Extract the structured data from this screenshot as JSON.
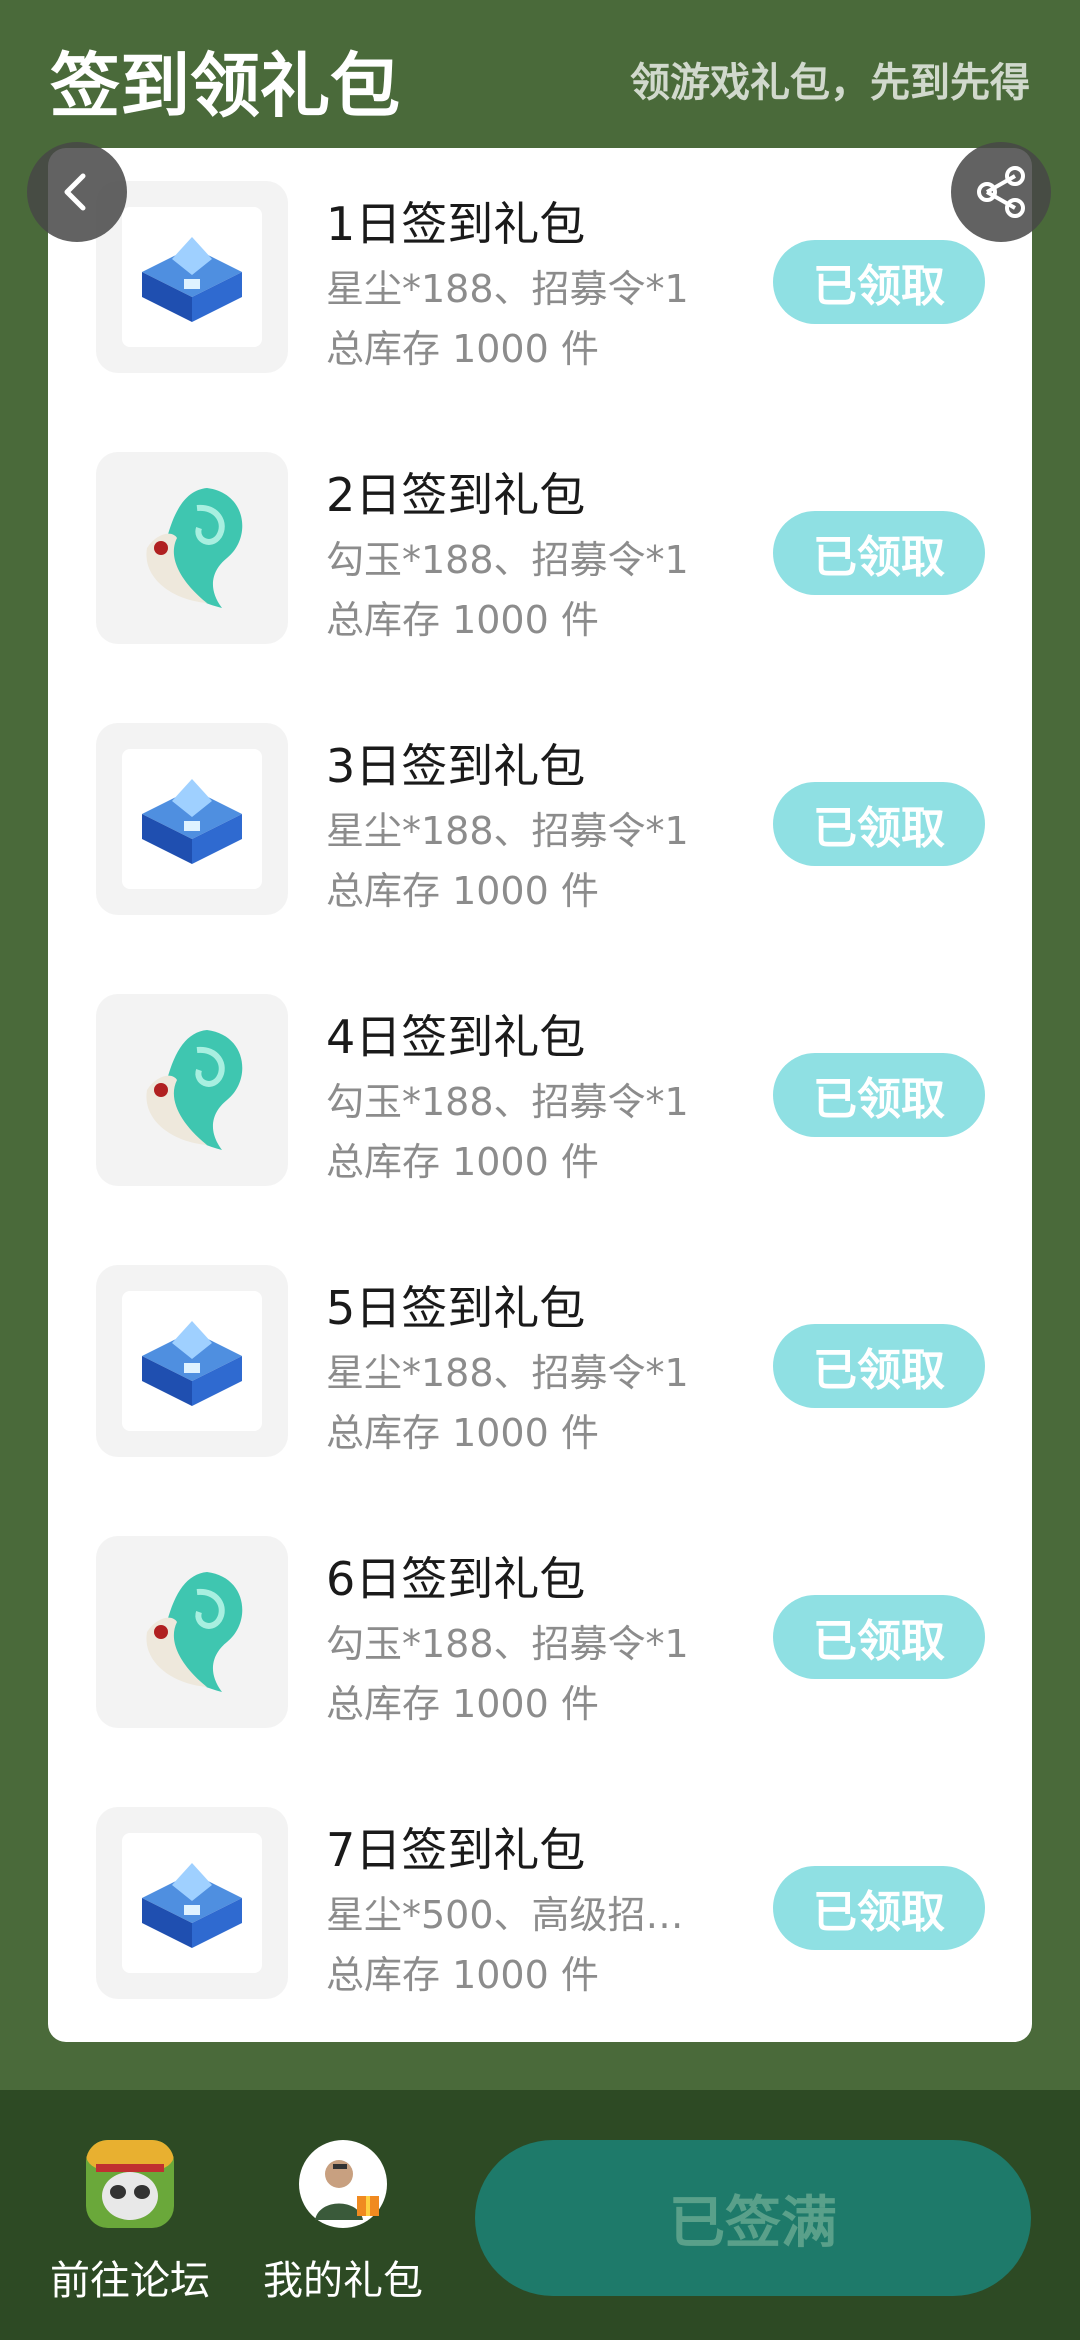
{
  "header": {
    "title": "签到领礼包",
    "subtitle": "领游戏礼包，先到先得"
  },
  "gifts": [
    {
      "name": "1日签到礼包",
      "items": "星尘*188、招募令*1",
      "stock": "总库存 1000 件",
      "button": "已领取",
      "icon": "blue-chest-icon"
    },
    {
      "name": "2日签到礼包",
      "items": "勾玉*188、招募令*1",
      "stock": "总库存 1000 件",
      "button": "已领取",
      "icon": "jade-magatama-icon"
    },
    {
      "name": "3日签到礼包",
      "items": "星尘*188、招募令*1",
      "stock": "总库存 1000 件",
      "button": "已领取",
      "icon": "blue-chest-icon"
    },
    {
      "name": "4日签到礼包",
      "items": "勾玉*188、招募令*1",
      "stock": "总库存 1000 件",
      "button": "已领取",
      "icon": "jade-magatama-icon"
    },
    {
      "name": "5日签到礼包",
      "items": "星尘*188、招募令*1",
      "stock": "总库存 1000 件",
      "button": "已领取",
      "icon": "blue-chest-icon"
    },
    {
      "name": "6日签到礼包",
      "items": "勾玉*188、招募令*1",
      "stock": "总库存 1000 件",
      "button": "已领取",
      "icon": "jade-magatama-icon"
    },
    {
      "name": "7日签到礼包",
      "items": "星尘*500、高级招…",
      "stock": "总库存 1000 件",
      "button": "已领取",
      "icon": "blue-chest-icon"
    }
  ],
  "footer": {
    "forum_label": "前往论坛",
    "mygifts_label": "我的礼包",
    "signed_label": "已签满"
  },
  "colors": {
    "background": "#4a6a3a",
    "claim_button": "#8fe0e3",
    "signed_button": "#1e7a6a",
    "footer": "#2d4a24"
  }
}
